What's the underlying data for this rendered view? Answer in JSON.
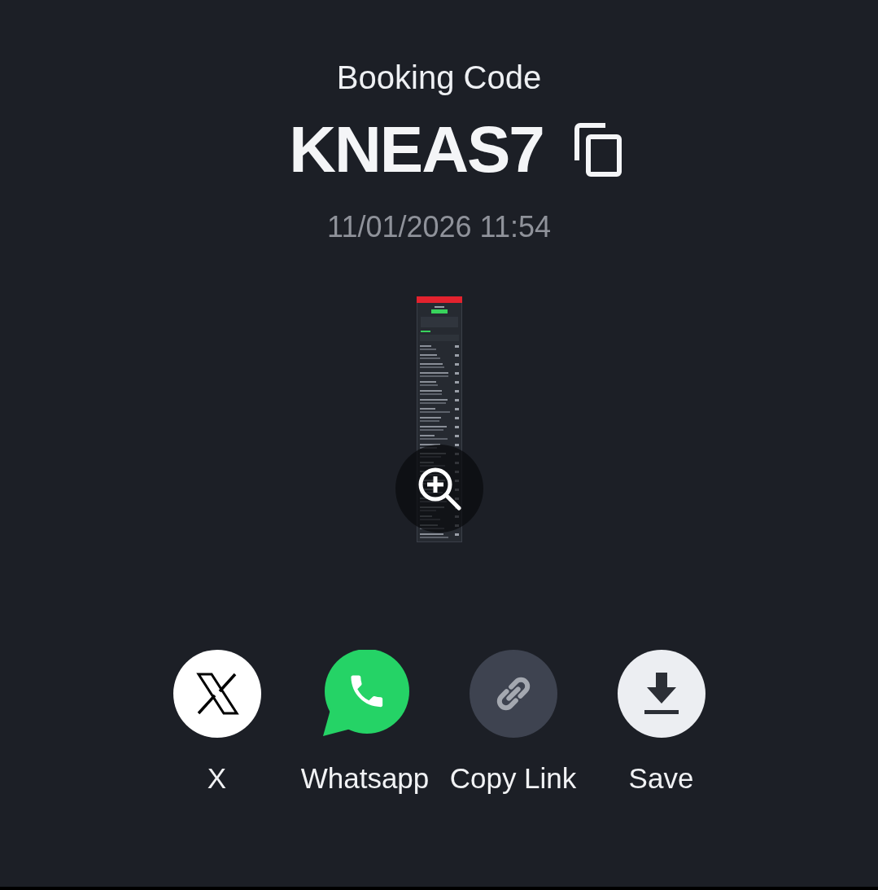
{
  "booking": {
    "label": "Booking Code",
    "code": "KNEAS7",
    "timestamp": "11/01/2026 11:54"
  },
  "share_options": [
    {
      "kind": "x",
      "label": "X"
    },
    {
      "kind": "whatsapp",
      "label": "Whatsapp"
    },
    {
      "kind": "copy_link",
      "label": "Copy Link"
    },
    {
      "kind": "save",
      "label": "Save"
    }
  ]
}
